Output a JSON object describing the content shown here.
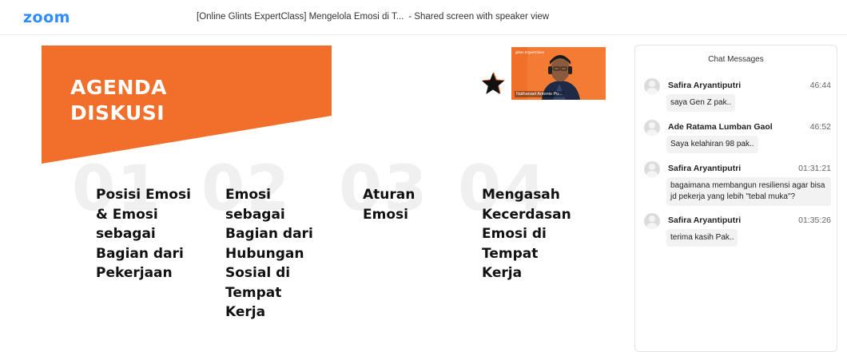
{
  "app": {
    "logo": "zoom"
  },
  "meeting": {
    "title": "[Online Glints ExpertClass] Mengelola Emosi di T...",
    "view_mode": "- Shared screen with speaker view"
  },
  "slide": {
    "title_line1": "AGENDA",
    "title_line2": "DISKUSI",
    "accent_color": "#f26f2b",
    "items": [
      {
        "number": "01",
        "text": "Posisi Emosi & Emosi sebagai Bagian dari Pekerjaan"
      },
      {
        "number": "02",
        "text": "Emosi sebagai Bagian dari Hubungan Sosial di Tempat Kerja"
      },
      {
        "number": "03",
        "text": "Aturan Emosi"
      },
      {
        "number": "04",
        "text": "Mengasah Kecerdasan Emosi di Tempat Kerja"
      }
    ]
  },
  "speaker_video": {
    "name_label": "Nathanael Antonio Pu...",
    "brand": "glints ExpertClass"
  },
  "chat": {
    "header": "Chat Messages",
    "messages": [
      {
        "sender": "Safira Aryantiputri",
        "time": "46:44",
        "text": "saya Gen Z pak.."
      },
      {
        "sender": "Ade Ratama Lumban Gaol",
        "time": "46:52",
        "text": "Saya kelahiran 98 pak.."
      },
      {
        "sender": "Safira Aryantiputri",
        "time": "01:31:21",
        "text": "bagaimana membangun resiliensi agar bisa jd pekerja yang lebih \"tebal muka\"?"
      },
      {
        "sender": "Safira Aryantiputri",
        "time": "01:35:26",
        "text": "terima kasih Pak.."
      }
    ]
  }
}
